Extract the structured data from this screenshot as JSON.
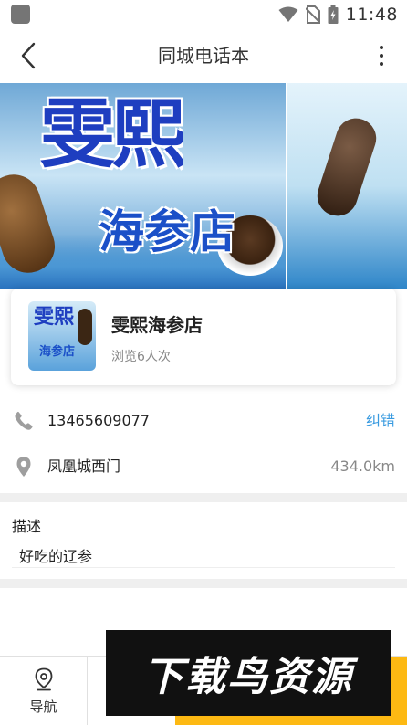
{
  "status_bar": {
    "time": "11:48"
  },
  "app_bar": {
    "title": "同城电话本"
  },
  "banner": {
    "title_line1": "雯熙",
    "title_line2": "海参店"
  },
  "shop": {
    "logo_text_1": "雯熙",
    "logo_text_2": "海参店",
    "name": "雯熙海参店",
    "views": "浏览6人次"
  },
  "contact": {
    "phone": "13465609077",
    "report_label": "纠错",
    "address": "凤凰城西门",
    "distance": "434.0km"
  },
  "description": {
    "title": "描述",
    "text": "好吃的辽参"
  },
  "bottom": {
    "nav_label": "导航"
  },
  "watermark": {
    "text": "下载鸟资源"
  },
  "colors": {
    "accent": "#3a9be0",
    "call_button": "#fdb913",
    "divider": "#efefef"
  }
}
